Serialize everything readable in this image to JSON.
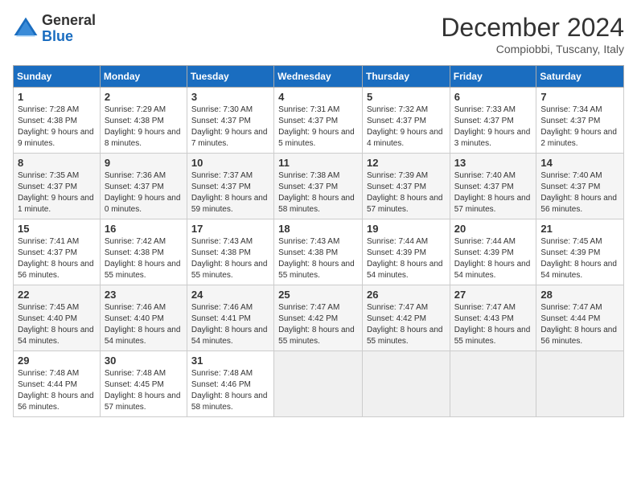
{
  "logo": {
    "general": "General",
    "blue": "Blue"
  },
  "title": {
    "month_year": "December 2024",
    "location": "Compiobbi, Tuscany, Italy"
  },
  "weekdays": [
    "Sunday",
    "Monday",
    "Tuesday",
    "Wednesday",
    "Thursday",
    "Friday",
    "Saturday"
  ],
  "weeks": [
    [
      {
        "day": "1",
        "sunrise": "7:28 AM",
        "sunset": "4:38 PM",
        "daylight": "9 hours and 9 minutes."
      },
      {
        "day": "2",
        "sunrise": "7:29 AM",
        "sunset": "4:38 PM",
        "daylight": "9 hours and 8 minutes."
      },
      {
        "day": "3",
        "sunrise": "7:30 AM",
        "sunset": "4:37 PM",
        "daylight": "9 hours and 7 minutes."
      },
      {
        "day": "4",
        "sunrise": "7:31 AM",
        "sunset": "4:37 PM",
        "daylight": "9 hours and 5 minutes."
      },
      {
        "day": "5",
        "sunrise": "7:32 AM",
        "sunset": "4:37 PM",
        "daylight": "9 hours and 4 minutes."
      },
      {
        "day": "6",
        "sunrise": "7:33 AM",
        "sunset": "4:37 PM",
        "daylight": "9 hours and 3 minutes."
      },
      {
        "day": "7",
        "sunrise": "7:34 AM",
        "sunset": "4:37 PM",
        "daylight": "9 hours and 2 minutes."
      }
    ],
    [
      {
        "day": "8",
        "sunrise": "7:35 AM",
        "sunset": "4:37 PM",
        "daylight": "9 hours and 1 minute."
      },
      {
        "day": "9",
        "sunrise": "7:36 AM",
        "sunset": "4:37 PM",
        "daylight": "9 hours and 0 minutes."
      },
      {
        "day": "10",
        "sunrise": "7:37 AM",
        "sunset": "4:37 PM",
        "daylight": "8 hours and 59 minutes."
      },
      {
        "day": "11",
        "sunrise": "7:38 AM",
        "sunset": "4:37 PM",
        "daylight": "8 hours and 58 minutes."
      },
      {
        "day": "12",
        "sunrise": "7:39 AM",
        "sunset": "4:37 PM",
        "daylight": "8 hours and 57 minutes."
      },
      {
        "day": "13",
        "sunrise": "7:40 AM",
        "sunset": "4:37 PM",
        "daylight": "8 hours and 57 minutes."
      },
      {
        "day": "14",
        "sunrise": "7:40 AM",
        "sunset": "4:37 PM",
        "daylight": "8 hours and 56 minutes."
      }
    ],
    [
      {
        "day": "15",
        "sunrise": "7:41 AM",
        "sunset": "4:37 PM",
        "daylight": "8 hours and 56 minutes."
      },
      {
        "day": "16",
        "sunrise": "7:42 AM",
        "sunset": "4:38 PM",
        "daylight": "8 hours and 55 minutes."
      },
      {
        "day": "17",
        "sunrise": "7:43 AM",
        "sunset": "4:38 PM",
        "daylight": "8 hours and 55 minutes."
      },
      {
        "day": "18",
        "sunrise": "7:43 AM",
        "sunset": "4:38 PM",
        "daylight": "8 hours and 55 minutes."
      },
      {
        "day": "19",
        "sunrise": "7:44 AM",
        "sunset": "4:39 PM",
        "daylight": "8 hours and 54 minutes."
      },
      {
        "day": "20",
        "sunrise": "7:44 AM",
        "sunset": "4:39 PM",
        "daylight": "8 hours and 54 minutes."
      },
      {
        "day": "21",
        "sunrise": "7:45 AM",
        "sunset": "4:39 PM",
        "daylight": "8 hours and 54 minutes."
      }
    ],
    [
      {
        "day": "22",
        "sunrise": "7:45 AM",
        "sunset": "4:40 PM",
        "daylight": "8 hours and 54 minutes."
      },
      {
        "day": "23",
        "sunrise": "7:46 AM",
        "sunset": "4:40 PM",
        "daylight": "8 hours and 54 minutes."
      },
      {
        "day": "24",
        "sunrise": "7:46 AM",
        "sunset": "4:41 PM",
        "daylight": "8 hours and 54 minutes."
      },
      {
        "day": "25",
        "sunrise": "7:47 AM",
        "sunset": "4:42 PM",
        "daylight": "8 hours and 55 minutes."
      },
      {
        "day": "26",
        "sunrise": "7:47 AM",
        "sunset": "4:42 PM",
        "daylight": "8 hours and 55 minutes."
      },
      {
        "day": "27",
        "sunrise": "7:47 AM",
        "sunset": "4:43 PM",
        "daylight": "8 hours and 55 minutes."
      },
      {
        "day": "28",
        "sunrise": "7:47 AM",
        "sunset": "4:44 PM",
        "daylight": "8 hours and 56 minutes."
      }
    ],
    [
      {
        "day": "29",
        "sunrise": "7:48 AM",
        "sunset": "4:44 PM",
        "daylight": "8 hours and 56 minutes."
      },
      {
        "day": "30",
        "sunrise": "7:48 AM",
        "sunset": "4:45 PM",
        "daylight": "8 hours and 57 minutes."
      },
      {
        "day": "31",
        "sunrise": "7:48 AM",
        "sunset": "4:46 PM",
        "daylight": "8 hours and 58 minutes."
      },
      null,
      null,
      null,
      null
    ]
  ],
  "labels": {
    "sunrise": "Sunrise:",
    "sunset": "Sunset:",
    "daylight": "Daylight:"
  }
}
